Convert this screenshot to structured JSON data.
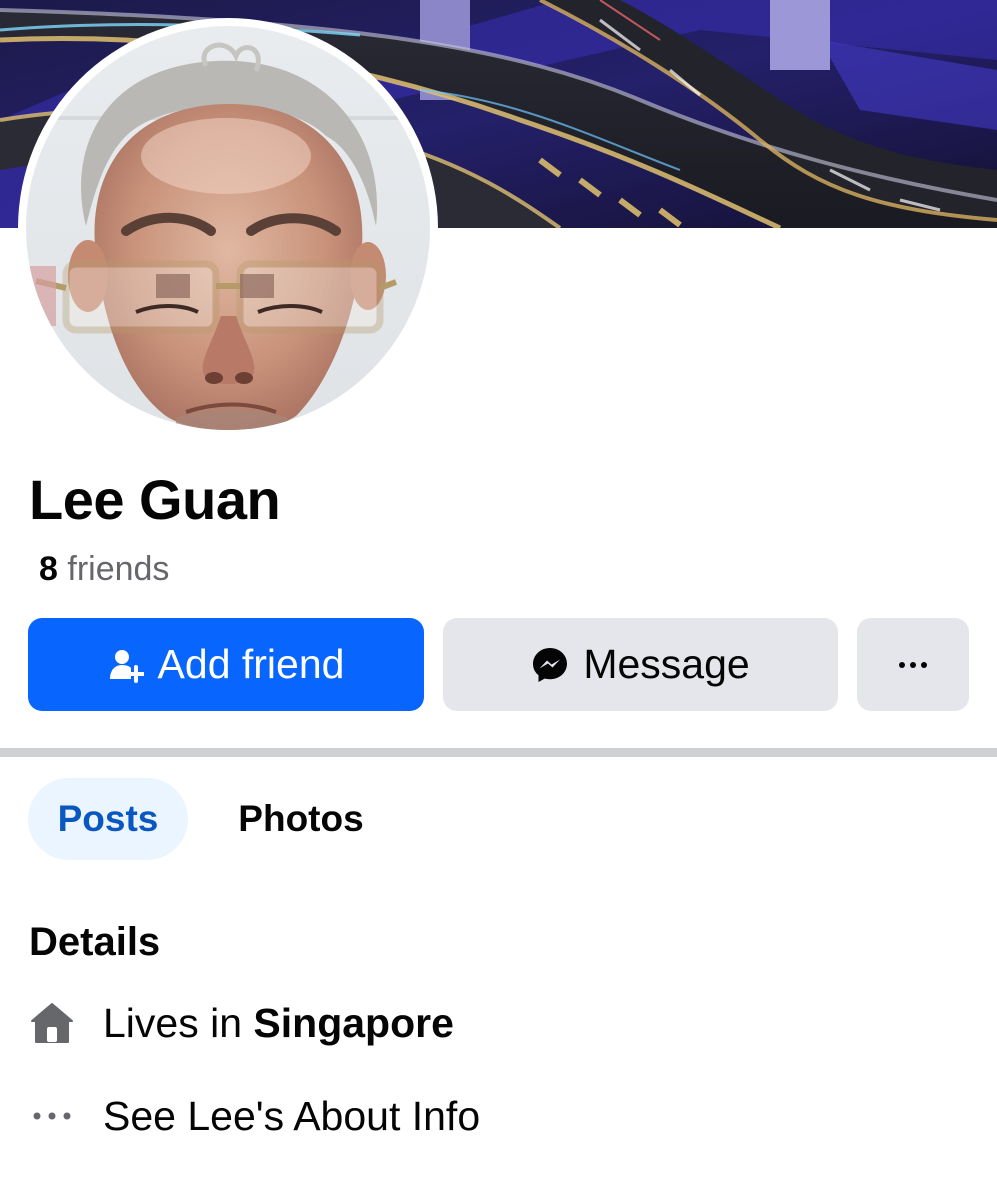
{
  "profile": {
    "name": "Lee Guan",
    "friends_count": "8",
    "friends_label": " friends"
  },
  "actions": {
    "add_friend_label": "Add friend",
    "message_label": "Message",
    "more_label": "···"
  },
  "tabs": [
    {
      "label": "Posts",
      "active": true
    },
    {
      "label": "Photos",
      "active": false
    }
  ],
  "details": {
    "heading": "Details",
    "lives_in_prefix": "Lives in ",
    "lives_in_place": "Singapore",
    "about_link": "See Lee's About Info"
  },
  "icons": {
    "add_friend": "person-add-icon",
    "message": "messenger-icon",
    "more": "more-dots-icon",
    "home": "home-icon",
    "about": "more-dots-icon"
  },
  "colors": {
    "primary": "#0866ff",
    "secondary_button": "#e4e6eb",
    "active_tab_bg": "#ebf5ff",
    "active_tab_text": "#0a57c2",
    "muted_text": "#65676b",
    "separator": "#ced0d4"
  }
}
